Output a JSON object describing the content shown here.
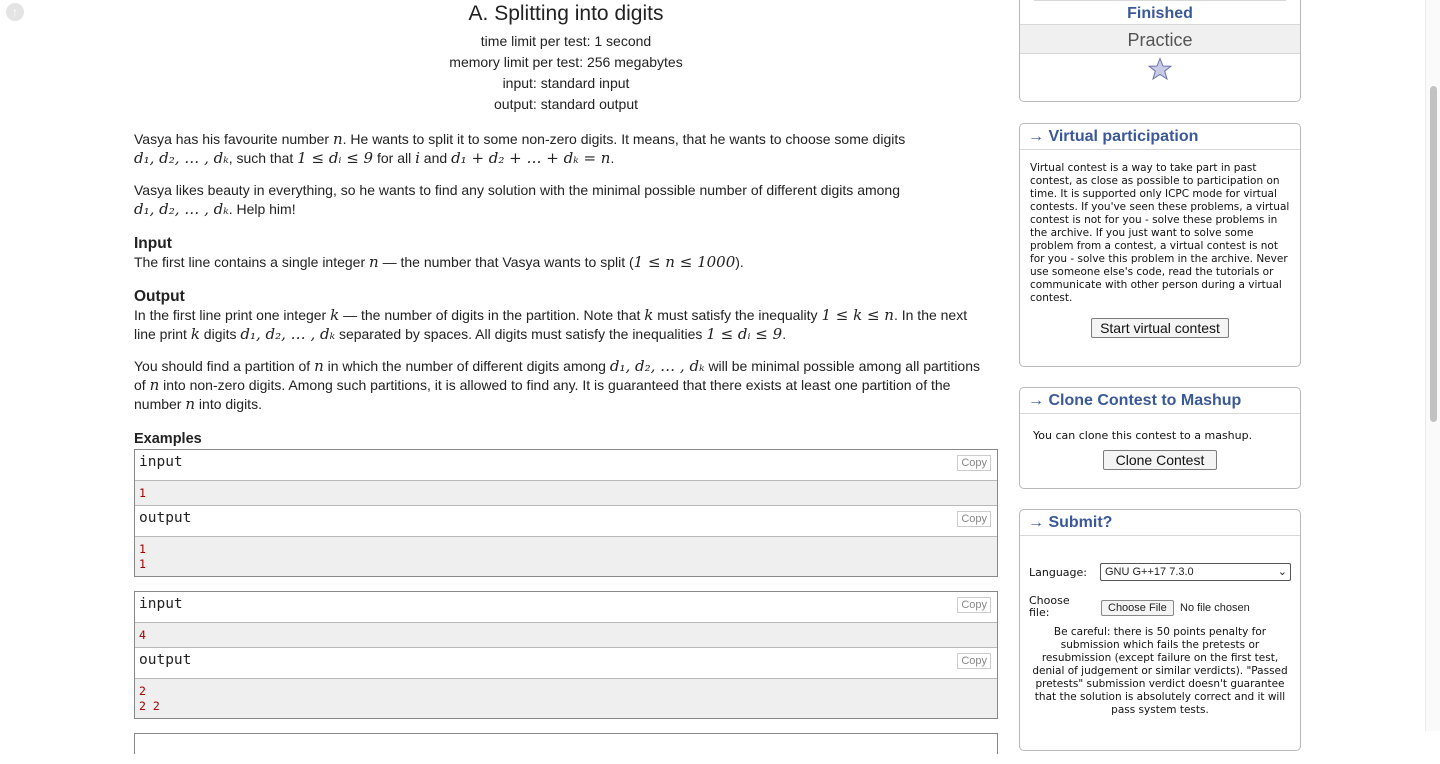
{
  "problem": {
    "title": "A. Splitting into digits",
    "limits": [
      "time limit per test: 1 second",
      "memory limit per test: 256 megabytes",
      "input: standard input",
      "output: standard output"
    ]
  },
  "statement": {
    "p1a": "Vasya has his favourite number ",
    "p1b": ". He wants to split it to some non-zero digits. It means, that he wants to choose some digits",
    "p1c": ", such that ",
    "p1d": " for all ",
    "p1e": " and ",
    "p2a": "Vasya likes beauty in everything, so he wants to find any solution with the minimal possible number of different digits among",
    "p2b": ". Help him!"
  },
  "input_section": {
    "title": "Input",
    "text_a": "The first line contains a single integer ",
    "text_b": " — the number that Vasya wants to split (",
    "text_c": ")."
  },
  "output_section": {
    "title": "Output",
    "text_a": "In the first line print one integer ",
    "text_b": " — the number of digits in the partition. Note that ",
    "text_c": " must satisfy the inequality ",
    "text_d": ". In the next",
    "text_e": "line print ",
    "text_f": " digits ",
    "text_g": " separated by spaces. All digits must satisfy the inequalities ",
    "text_h": "."
  },
  "note": {
    "a": "You should find a partition of ",
    "b": " in which the number of different digits among ",
    "c": " will be minimal possible among all partitions",
    "d": "of ",
    "e": " into non-zero digits. Among such partitions, it is allowed to find any. It is guaranteed that there exists at least one partition of the",
    "f": "number ",
    "g": " into digits."
  },
  "examples": {
    "title": "Examples",
    "input_label": "input",
    "output_label": "output",
    "copy_label": "Copy",
    "ex1_in": "1",
    "ex1_out": [
      "1",
      "1"
    ],
    "ex2_in": "4",
    "ex2_out": [
      "2",
      "2 2"
    ]
  },
  "sidebar": {
    "status": "Finished",
    "practice": "Practice",
    "virtual": {
      "title": "→ Virtual participation",
      "text": "Virtual contest is a way to take part in past contest, as close as possible to participation on time. It is supported only ICPC mode for virtual contests. If you've seen these problems, a virtual contest is not for you - solve these problems in the archive. If you just want to solve some problem from a contest, a virtual contest is not for you - solve this problem in the archive. Never use someone else's code, read the tutorials or communicate with other person during a virtual contest.",
      "button": "Start virtual contest"
    },
    "clone": {
      "title": "→ Clone Contest to Mashup",
      "text": "You can clone this contest to a mashup.",
      "button": "Clone Contest"
    },
    "submit": {
      "title": "→ Submit?",
      "language_label": "Language:",
      "language_value": "GNU G++17 7.3.0",
      "file_label": "Choose file:",
      "file_button": "Choose File",
      "file_status": "No file chosen",
      "warning": "Be careful: there is 50 points penalty for submission which fails the pretests or resubmission (except failure on the first test, denial of judgement or similar verdicts). \"Passed pretests\" submission verdict doesn't guarantee that the solution is absolutely correct and it will pass system tests."
    }
  },
  "math": {
    "n": "n",
    "i": "i",
    "k": "k",
    "digits_seq": "d₁, d₂, … , dₖ",
    "di_range": "1 ≤ dᵢ ≤ 9",
    "sum": "d₁ + d₂ + … + dₖ = n",
    "n_range": "1 ≤ n ≤ 1000",
    "k_range": "1 ≤ k ≤ n"
  }
}
